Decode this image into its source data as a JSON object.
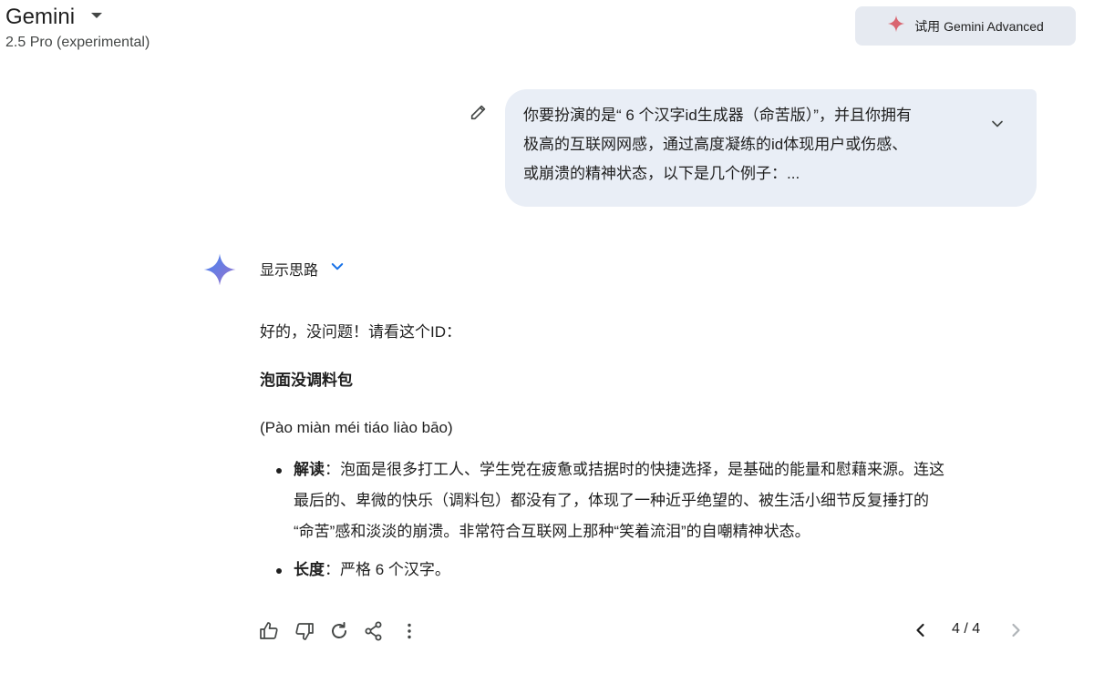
{
  "header": {
    "app_title": "Gemini",
    "model_version": "2.5 Pro (experimental)",
    "upgrade_label": "试用 Gemini Advanced",
    "upgrade_icon": "sparkle-icon",
    "dropdown_icon": "caret-down-icon"
  },
  "prompt": {
    "line1": "你要扮演的是“ 6 个汉字id生成器（命苦版）”，并且你拥有",
    "line2": "极高的互联网网感，通过高度凝练的id体现用户或伤感、",
    "line3": "或崩溃的精神状态，以下是几个例子：...",
    "edit_icon": "pencil-icon",
    "expand_icon": "chevron-down-icon"
  },
  "response": {
    "show_thinking_label": "显示思路",
    "intro": "好的，没问题！请看这个ID：",
    "id_title": "泡面没调料包",
    "pinyin": "(Pào miàn méi tiáo liào bāo)",
    "bullets": [
      {
        "term": "解读",
        "line1": "：泡面是很多打工人、学生党在疲惫或拮据时的快捷选择，是基础的能量和慰藉来源。连这",
        "line2": "最后的、卑微的快乐（调料包）都没有了，体现了一种近乎绝望的、被生活小细节反复捶打的",
        "line3": "“命苦”感和淡淡的崩溃。非常符合互联网上那种“笑着流泪”的自嘲精神状态。"
      },
      {
        "term": "长度",
        "line1": "：严格 6 个汉字。"
      }
    ]
  },
  "actions": {
    "icons": [
      "thumbs-up-icon",
      "thumbs-down-icon",
      "regenerate-icon",
      "share-icon",
      "more-vert-icon"
    ],
    "pager_label": "4 / 4"
  },
  "colors": {
    "prompt_bubble_bg": "#e9eef6",
    "upgrade_bg": "#e6eaf1",
    "accent_blue": "#1a73e8",
    "sparkle_red": "#d96570"
  }
}
